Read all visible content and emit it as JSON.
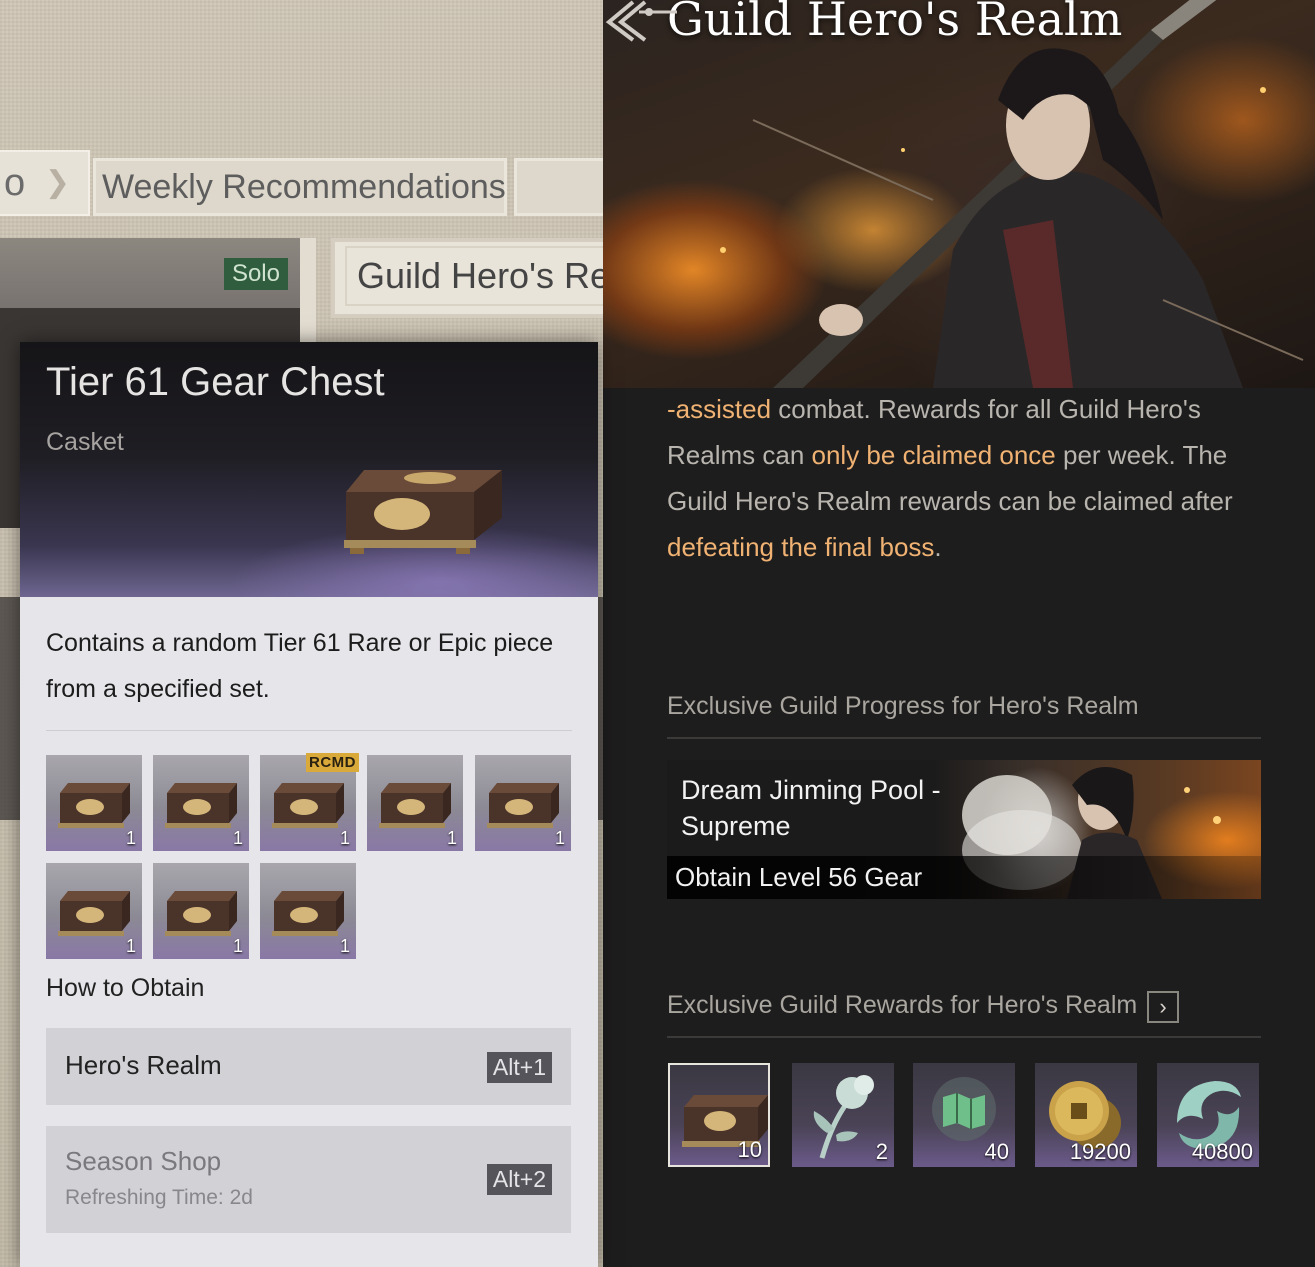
{
  "background": {
    "tab_prev_label": "o",
    "tab_weekly_label": "Weekly Recommendations",
    "card_solo_tag": "Solo",
    "card_guild_title": "Guild Hero's Re"
  },
  "realm_panel": {
    "title": "Guild Hero's Realm",
    "description": {
      "p1_hl": "-assisted",
      "p2": " combat. Rewards for all Guild Hero's Realms can ",
      "p3_hl": "only be claimed once",
      "p4": " per week. The Guild Hero's Realm rewards can be claimed after ",
      "p5_hl": "defeating the final boss",
      "p6": "."
    },
    "progress_section_label": "Exclusive Guild Progress for Hero's Realm",
    "progress": {
      "name": "Dream Jinming Pool - Supreme",
      "goal": "Obtain Level 56 Gear"
    },
    "rewards_section_label": "Exclusive Guild Rewards for Hero's Realm",
    "rewards": [
      {
        "icon": "gear-chest-icon",
        "qty": "10"
      },
      {
        "icon": "flower-icon",
        "qty": "2"
      },
      {
        "icon": "map-icon",
        "qty": "40"
      },
      {
        "icon": "coins-icon",
        "qty": "19200"
      },
      {
        "icon": "swirl-icon",
        "qty": "40800"
      }
    ]
  },
  "tooltip": {
    "title": "Tier 61 Gear Chest",
    "subtitle": "Casket",
    "description": "Contains a random Tier 61 Rare or Epic piece from a specified set.",
    "chests": [
      {
        "qty": "1"
      },
      {
        "qty": "1"
      },
      {
        "qty": "1",
        "badge": "RCMD"
      },
      {
        "qty": "1"
      },
      {
        "qty": "1"
      },
      {
        "qty": "1"
      },
      {
        "qty": "1"
      },
      {
        "qty": "1"
      }
    ],
    "obtain_title": "How to Obtain",
    "obtain": [
      {
        "label": "Hero's Realm",
        "key": "Alt+1"
      },
      {
        "label": "Season Shop",
        "sub": "Refreshing Time: 2d",
        "key": "Alt+2"
      }
    ]
  },
  "colors": {
    "highlight": "#f0b272",
    "panel_bg": "#1e1d1d",
    "tooltip_bg": "#e6e5ea",
    "rcmd_badge": "#d9a93a",
    "solo_tag": "#2f5d3e"
  }
}
